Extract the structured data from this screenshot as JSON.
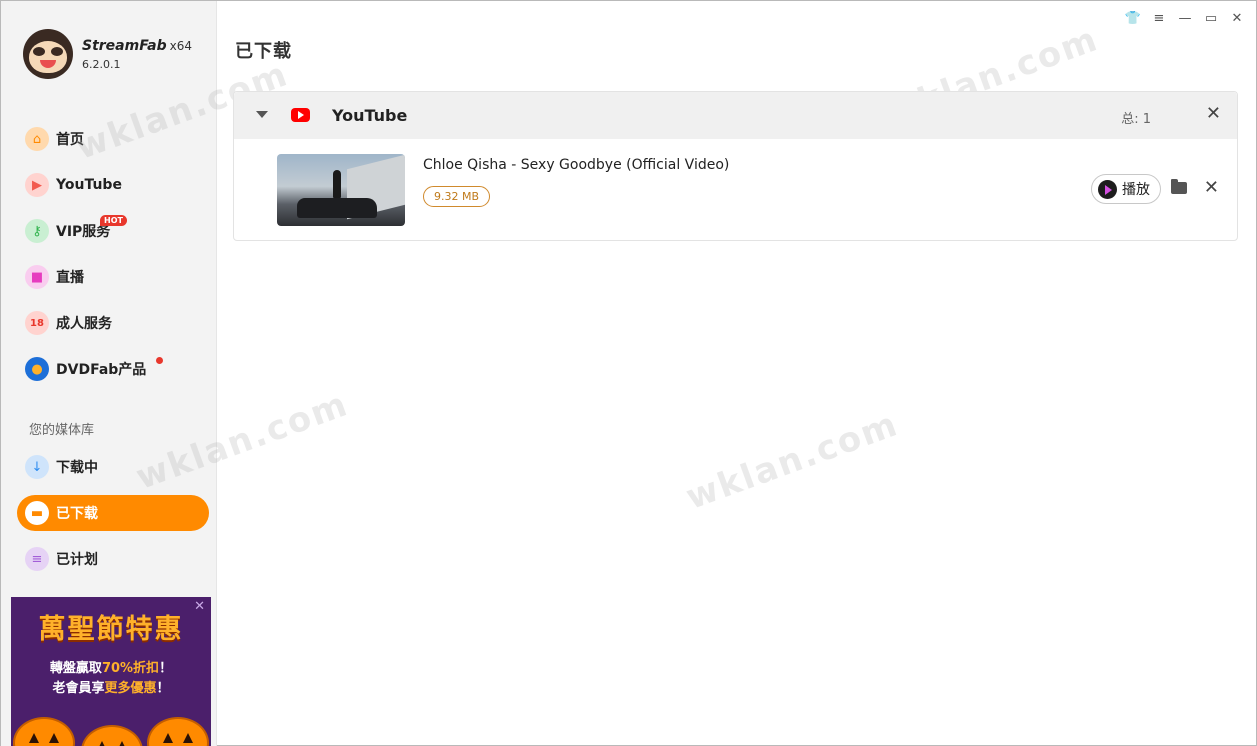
{
  "app": {
    "name": "StreamFab",
    "arch": "x64",
    "version": "6.2.0.1"
  },
  "nav": {
    "items": [
      {
        "label": "首页",
        "icon": "home-icon",
        "color": "#ff9a2e"
      },
      {
        "label": "YouTube",
        "icon": "youtube-icon",
        "color": "#f25a4e"
      },
      {
        "label": "VIP服务",
        "icon": "key-icon",
        "color": "#2fb24c",
        "badge": "HOT"
      },
      {
        "label": "直播",
        "icon": "live-camera-icon",
        "color": "#e63cbf"
      },
      {
        "label": "成人服务",
        "icon": "adult-18-icon",
        "color": "#e8372c"
      },
      {
        "label": "DVDFab产品",
        "icon": "dvdfab-icon",
        "color": "#1d6fd8"
      }
    ],
    "library_label": "您的媒体库",
    "library": [
      {
        "label": "下载中",
        "icon": "download-arrow-icon",
        "color": "#2d8cf0"
      },
      {
        "label": "已下载",
        "icon": "folder-icon",
        "color": "#ffffff",
        "active": true
      },
      {
        "label": "已计划",
        "icon": "list-icon",
        "color": "#a35ed8"
      }
    ]
  },
  "promo": {
    "title": "萬聖節特惠",
    "line1_a": "轉盤贏取",
    "line1_hl": "70%折扣",
    "line1_b": "！",
    "line2_a": "老會員享",
    "line2_hl": "更多優惠",
    "line2_b": "！",
    "close": "✕"
  },
  "page": {
    "title": "已下载"
  },
  "group": {
    "name": "YouTube",
    "count_label": "总: 1",
    "close": "✕"
  },
  "item": {
    "title": "Chloe Qisha - Sexy Goodbye (Official Video)",
    "size": "9.32 MB",
    "play_label": "播放",
    "close": "✕"
  },
  "watermark": "wklan.com",
  "colors": {
    "accent": "#ff8a00",
    "youtube": "#ff0000",
    "badge": "#e8372c"
  }
}
